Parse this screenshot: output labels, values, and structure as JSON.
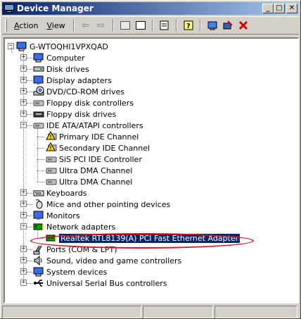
{
  "window": {
    "title": "Device Manager"
  },
  "menu": {
    "items": [
      {
        "label": "Action",
        "underline": "A",
        "rest": "ction"
      },
      {
        "label": "View",
        "underline": "V",
        "rest": "iew"
      }
    ]
  },
  "tree": {
    "root": "G-WTOQHI1VPXQAD",
    "items": [
      {
        "label": "Computer",
        "icon": "computer-icon",
        "expanded": false
      },
      {
        "label": "Disk drives",
        "icon": "disk-drive-icon",
        "expanded": false
      },
      {
        "label": "Display adapters",
        "icon": "display-icon",
        "expanded": false
      },
      {
        "label": "DVD/CD-ROM drives",
        "icon": "cdrom-icon",
        "expanded": false
      },
      {
        "label": "Floppy disk controllers",
        "icon": "controller-icon",
        "expanded": false
      },
      {
        "label": "Floppy disk drives",
        "icon": "floppy-icon",
        "expanded": false
      },
      {
        "label": "IDE ATA/ATAPI controllers",
        "icon": "controller-icon",
        "expanded": true,
        "children": [
          {
            "label": "Primary IDE Channel",
            "icon": "warning-icon"
          },
          {
            "label": "Secondary IDE Channel",
            "icon": "warning-icon"
          },
          {
            "label": "SiS PCI IDE Controller",
            "icon": "controller-icon"
          },
          {
            "label": "Ultra DMA Channel",
            "icon": "controller-icon"
          },
          {
            "label": "Ultra DMA Channel",
            "icon": "controller-icon"
          }
        ]
      },
      {
        "label": "Keyboards",
        "icon": "keyboard-icon",
        "expanded": false
      },
      {
        "label": "Mice and other pointing devices",
        "icon": "mouse-icon",
        "expanded": false
      },
      {
        "label": "Monitors",
        "icon": "monitor-icon",
        "expanded": false
      },
      {
        "label": "Network adapters",
        "icon": "network-icon",
        "expanded": true,
        "children": [
          {
            "label": "Realtek RTL8139(A) PCI Fast Ethernet Adapter",
            "icon": "network-card-icon",
            "selected": true
          }
        ]
      },
      {
        "label": "Ports (COM & LPT)",
        "icon": "port-icon",
        "expanded": false
      },
      {
        "label": "Sound, video and game controllers",
        "icon": "sound-icon",
        "expanded": false
      },
      {
        "label": "System devices",
        "icon": "system-icon",
        "expanded": false
      },
      {
        "label": "Universal Serial Bus controllers",
        "icon": "usb-icon",
        "expanded": false
      }
    ]
  },
  "colors": {
    "title_start": "#0a246a",
    "title_end": "#a6caf0",
    "selection": "#0a246a",
    "annotation": "#e0101a"
  }
}
